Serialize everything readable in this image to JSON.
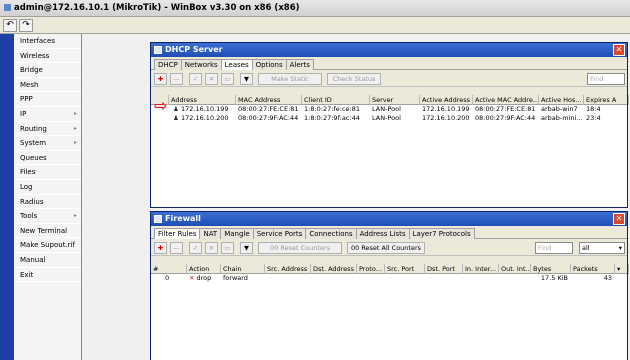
{
  "app": {
    "title": "admin@172.16.10.1 (MikroTik) - WinBox v3.30 on x86 (x86)"
  },
  "toolbar": {
    "undo": "↶",
    "redo": "↷"
  },
  "sidebar": {
    "items": [
      {
        "label": "Interfaces",
        "sub": ""
      },
      {
        "label": "Wireless",
        "sub": ""
      },
      {
        "label": "Bridge",
        "sub": ""
      },
      {
        "label": "Mesh",
        "sub": ""
      },
      {
        "label": "PPP",
        "sub": ""
      },
      {
        "label": "IP",
        "sub": "▸"
      },
      {
        "label": "Routing",
        "sub": "▸"
      },
      {
        "label": "System",
        "sub": "▸"
      },
      {
        "label": "Queues",
        "sub": ""
      },
      {
        "label": "Files",
        "sub": ""
      },
      {
        "label": "Log",
        "sub": ""
      },
      {
        "label": "Radius",
        "sub": ""
      },
      {
        "label": "Tools",
        "sub": "▸"
      },
      {
        "label": "New Terminal",
        "sub": ""
      },
      {
        "label": "Make Supout.rif",
        "sub": ""
      },
      {
        "label": "Manual",
        "sub": ""
      },
      {
        "label": "Exit",
        "sub": ""
      }
    ]
  },
  "dhcp": {
    "title": "DHCP Server",
    "tabs": [
      "DHCP",
      "Networks",
      "Leases",
      "Options",
      "Alerts"
    ],
    "buttons": {
      "add": "✚",
      "remove": "—",
      "enable": "✓",
      "disable": "✕",
      "comment": "▭",
      "filter": "▼",
      "make_static": "Make Static",
      "check_status": "Check Status"
    },
    "find_placeholder": "Find",
    "columns": [
      "Address",
      "MAC Address",
      "Client ID",
      "Server",
      "Active Address",
      "Active MAC Addre...",
      "Active Hos...",
      "Expires A"
    ],
    "rows": [
      [
        "172.16.10.199",
        "08:00:27:FE:CE:81",
        "1:8:0:27:fe:ce:81",
        "LAN-Pool",
        "172.16.10.199",
        "08:00:27:FE:CE:81",
        "arbab-win7",
        "18:4"
      ],
      [
        "172.16.10.200",
        "08:00:27:9F:AC:44",
        "1:8:0:27:9f:ac:44",
        "LAN-Pool",
        "172.16.10.200",
        "08:00:27:9F:AC:44",
        "arbab-mini...",
        "23:4"
      ]
    ]
  },
  "firewall": {
    "title": "Firewall",
    "tabs": [
      "Filter Rules",
      "NAT",
      "Mangle",
      "Service Ports",
      "Connections",
      "Address Lists",
      "Layer7 Protocols"
    ],
    "buttons": {
      "add": "✚",
      "remove": "—",
      "enable": "✓",
      "disable": "✕",
      "comment": "▭",
      "filter": "▼",
      "reset_counters": "Reset Counters",
      "reset_all_counters": "Reset All Counters",
      "reset_prefix": "00"
    },
    "find_placeholder": "Find",
    "select_value": "all",
    "columns": [
      "#",
      "Action",
      "Chain",
      "Src. Address",
      "Dst. Address",
      "Proto...",
      "Src. Port",
      "Dst. Port",
      "In. Inter...",
      "Out. Int...",
      "Bytes",
      "Packets"
    ],
    "rows": [
      [
        "0",
        "drop",
        "forward",
        "",
        "",
        "",
        "",
        "",
        "",
        "",
        "17.5 KiB",
        "43"
      ]
    ]
  },
  "colors": {
    "accent": "#1f4fb4",
    "arrow": "#e02020",
    "drop": "#d02020"
  }
}
